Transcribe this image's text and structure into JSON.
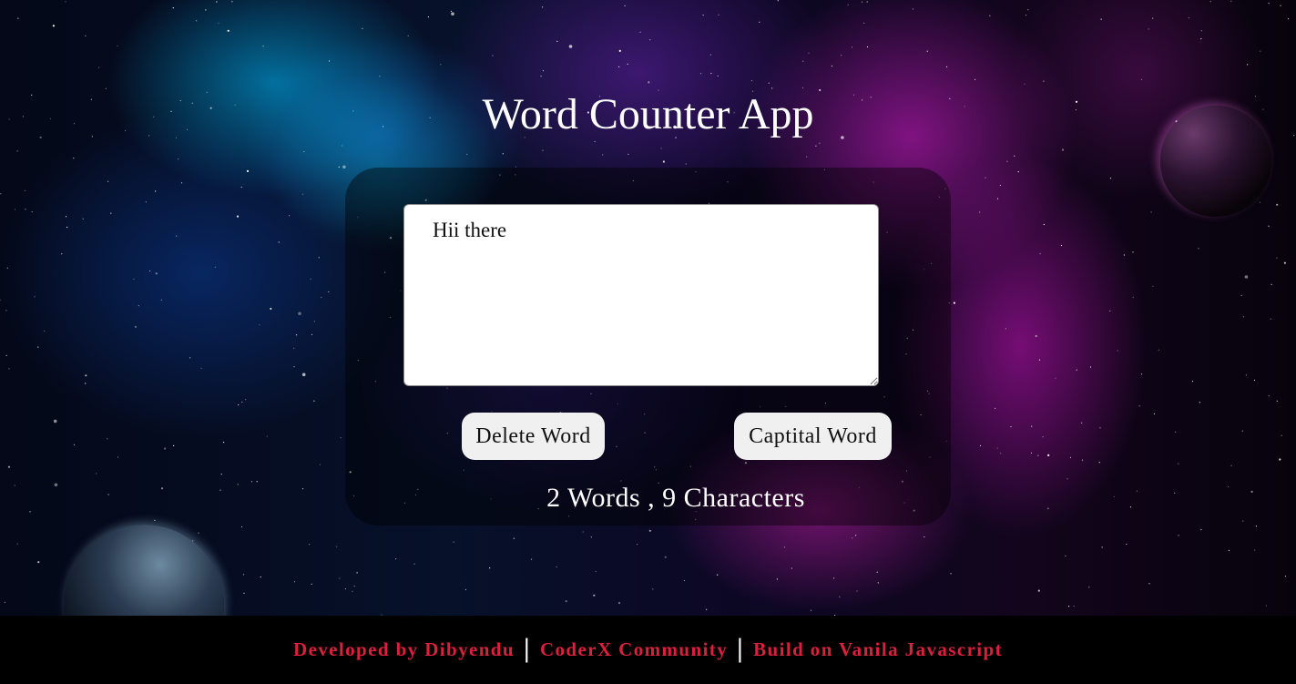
{
  "app": {
    "title": "Word Counter App"
  },
  "editor": {
    "value": "Hii there",
    "placeholder": ""
  },
  "buttons": {
    "delete_label": "Delete Word",
    "capital_label": "Captital Word"
  },
  "stats": {
    "text": "2 Words , 9 Characters"
  },
  "footer": {
    "developer": "Developed by Dibyendu",
    "separator": "|",
    "community": "CoderX Community",
    "build": "Build on Vanila Javascript"
  },
  "colors": {
    "footer_link": "#dc1f3c",
    "footer_bg": "#000000",
    "card_bg": "rgba(0,0,0,0.42)"
  }
}
